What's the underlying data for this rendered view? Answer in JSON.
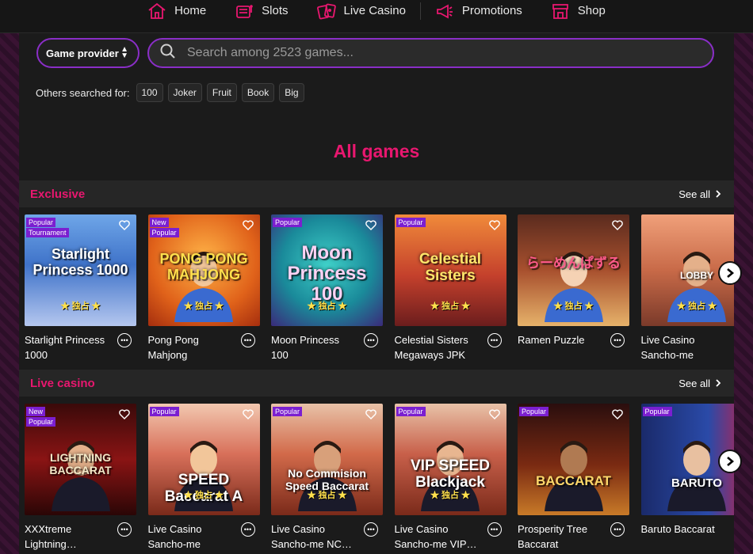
{
  "nav": {
    "items": [
      {
        "label": "Home",
        "icon": "home-icon"
      },
      {
        "label": "Slots",
        "icon": "slots-icon"
      },
      {
        "label": "Live Casino",
        "icon": "cards-icon"
      },
      {
        "label": "Promotions",
        "icon": "megaphone-icon"
      },
      {
        "label": "Shop",
        "icon": "shop-icon"
      }
    ]
  },
  "search": {
    "provider_label": "Game provider",
    "placeholder": "Search among 2523 games...",
    "others_label": "Others searched for:",
    "chips": [
      "100",
      "Joker",
      "Fruit",
      "Book",
      "Big"
    ]
  },
  "heading": "All games",
  "colors": {
    "accent": "#e8176f",
    "border": "#8a2ec7",
    "badge": "#7b1fd0"
  },
  "sections": [
    {
      "title": "Exclusive",
      "see_all": "See all",
      "games": [
        {
          "name": "Starlight Princess 1000",
          "badges": [
            "Popular",
            "Tournament"
          ],
          "art_title": "Starlight Princess 1000",
          "art_sub": "★ 独占 ★"
        },
        {
          "name": "Pong Pong Mahjong",
          "badges": [
            "New",
            "Popular"
          ],
          "art_title": "PONG PONG MAHJONG",
          "art_sub": "★ 独占 ★"
        },
        {
          "name": "Moon Princess 100",
          "badges": [
            "Popular"
          ],
          "art_title": "Moon Princess 100",
          "art_sub": "★ 独占 ★"
        },
        {
          "name": "Celestial Sisters Megaways JPK",
          "badges": [
            "Popular"
          ],
          "art_title": "Celestial Sisters",
          "art_sub": "★ 独占 ★"
        },
        {
          "name": "Ramen Puzzle",
          "badges": [],
          "art_title": "らーめんぱずる",
          "art_sub": "★ 独占 ★"
        },
        {
          "name": "Live Casino Sancho-me",
          "badges": [],
          "art_title": "LOBBY",
          "art_sub": "★ 独占 ★"
        }
      ]
    },
    {
      "title": "Live casino",
      "see_all": "See all",
      "games": [
        {
          "name": "XXXtreme Lightning…",
          "badges": [
            "New",
            "Popular"
          ],
          "art_title": "LIGHTNING BACCARAT",
          "art_sub": ""
        },
        {
          "name": "Live Casino Sancho-me Spee…",
          "badges": [
            "Popular"
          ],
          "art_title": "SPEED Baccarat A",
          "art_sub": "★ 独占 ★"
        },
        {
          "name": "Live Casino Sancho-me NC…",
          "badges": [
            "Popular"
          ],
          "art_title": "No Commision Speed Baccarat",
          "art_sub": "★ 独占 ★"
        },
        {
          "name": "Live Casino Sancho-me VIP…",
          "badges": [
            "Popular"
          ],
          "art_title": "VIP SPEED Blackjack",
          "art_sub": "★ 独占 ★"
        },
        {
          "name": "Prosperity Tree Baccarat",
          "badges": [
            "Popular"
          ],
          "art_title": "BACCARAT",
          "art_sub": ""
        },
        {
          "name": "Baruto Baccarat",
          "badges": [
            "Popular"
          ],
          "art_title": "BARUTO",
          "art_sub": ""
        }
      ]
    }
  ]
}
